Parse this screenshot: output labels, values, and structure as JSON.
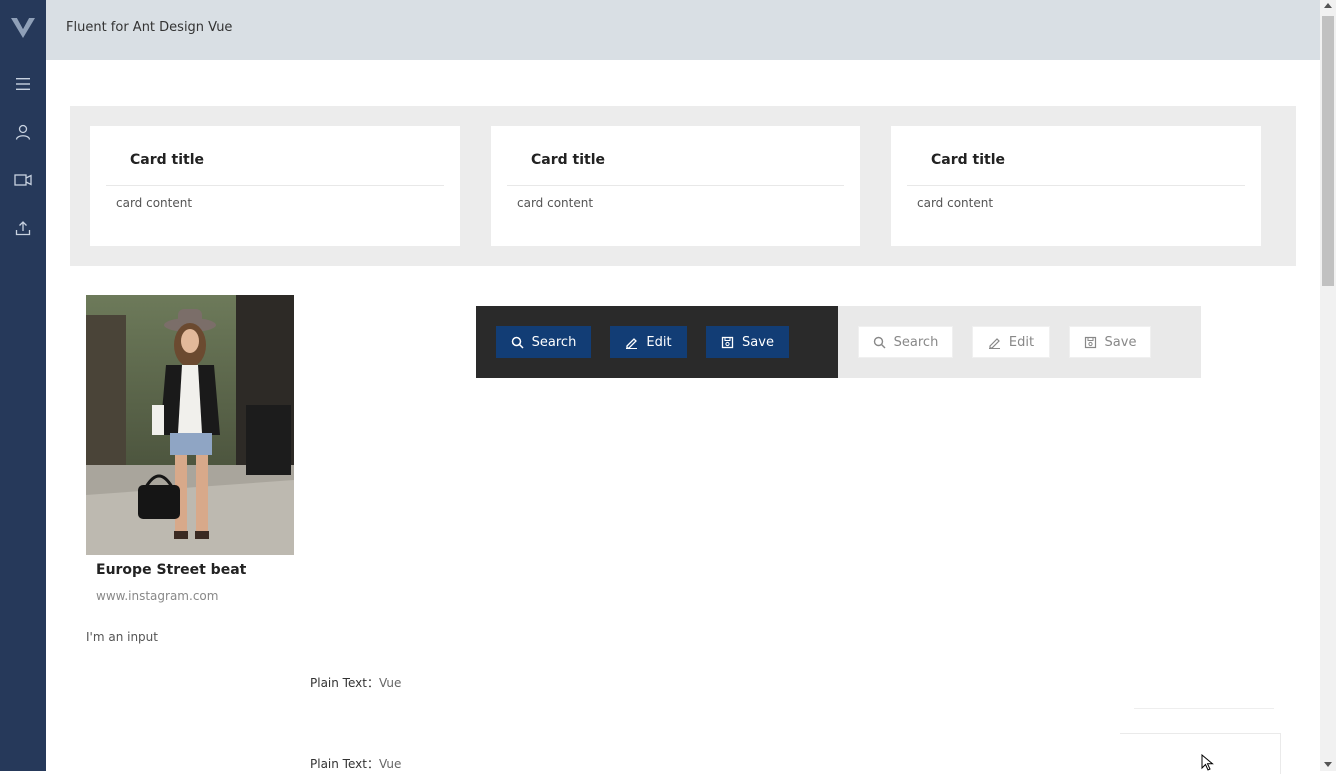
{
  "header": {
    "title": "Fluent for Ant Design Vue"
  },
  "sidebar": {
    "items": [
      {
        "icon": "menu-icon"
      },
      {
        "icon": "user-icon"
      },
      {
        "icon": "video-icon"
      },
      {
        "icon": "upload-icon"
      }
    ]
  },
  "cards": [
    {
      "title": "Card title",
      "content": "card content"
    },
    {
      "title": "Card title",
      "content": "card content"
    },
    {
      "title": "Card title",
      "content": "card content"
    }
  ],
  "photo_card": {
    "title": "Europe Street beat",
    "description": "www.instagram.com"
  },
  "input_label": "I'm an input",
  "buttons_dark": [
    {
      "label": "Search",
      "icon": "search-icon"
    },
    {
      "label": "Edit",
      "icon": "edit-icon"
    },
    {
      "label": "Save",
      "icon": "save-icon"
    }
  ],
  "buttons_light": [
    {
      "label": "Search",
      "icon": "search-icon"
    },
    {
      "label": "Edit",
      "icon": "edit-icon"
    },
    {
      "label": "Save",
      "icon": "save-icon"
    }
  ],
  "plain_rows": [
    {
      "label": "Plain Text：",
      "value": "Vue"
    },
    {
      "label": "Plain Text：",
      "value": "Vue"
    }
  ],
  "colors": {
    "sidebar": "#26395a",
    "header": "#d9dfe4",
    "primary": "#123d75",
    "dark_bar": "#2a2a2a"
  }
}
